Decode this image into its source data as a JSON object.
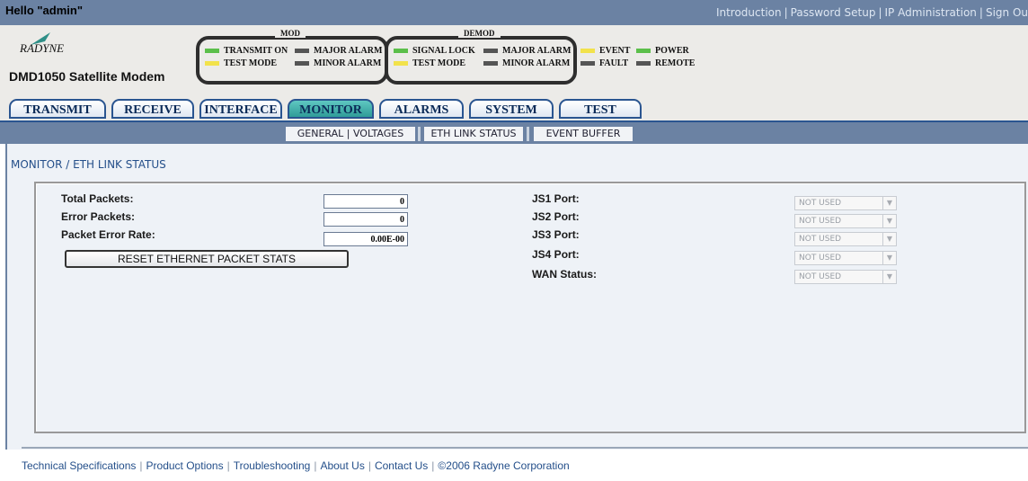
{
  "topbar": {
    "greeting": "Hello \"admin\"",
    "links": [
      "Introduction",
      "Password Setup",
      "IP Administration",
      "Sign Ou"
    ]
  },
  "header": {
    "logo_text": "RADYNE",
    "model": "DMD1050 Satellite Modem",
    "mod": {
      "title": "MOD",
      "indicators": [
        {
          "label": "TRANSMIT ON",
          "color": "#5bbf4a"
        },
        {
          "label": "MAJOR ALARM",
          "color": "#555555"
        },
        {
          "label": "TEST MODE",
          "color": "#f2e24b"
        },
        {
          "label": "MINOR ALARM",
          "color": "#555555"
        }
      ]
    },
    "demod": {
      "title": "DEMOD",
      "indicators": [
        {
          "label": "SIGNAL LOCK",
          "color": "#5bbf4a"
        },
        {
          "label": "MAJOR ALARM",
          "color": "#555555"
        },
        {
          "label": "TEST MODE",
          "color": "#f2e24b"
        },
        {
          "label": "MINOR ALARM",
          "color": "#555555"
        }
      ]
    },
    "general": [
      {
        "label": "EVENT",
        "color": "#f2e24b"
      },
      {
        "label": "POWER",
        "color": "#5bbf4a"
      },
      {
        "label": "FAULT",
        "color": "#555555"
      },
      {
        "label": "REMOTE",
        "color": "#555555"
      }
    ]
  },
  "tabs": [
    "TRANSMIT",
    "RECEIVE",
    "INTERFACE",
    "MONITOR",
    "ALARMS",
    "SYSTEM",
    "TEST"
  ],
  "active_tab": "MONITOR",
  "subnav": [
    "GENERAL | VOLTAGES",
    "ETH LINK STATUS",
    "EVENT BUFFER"
  ],
  "breadcrumb": "MONITOR / ETH LINK STATUS",
  "stats": {
    "total_packets_label": "Total Packets:",
    "total_packets_value": "0",
    "error_packets_label": "Error Packets:",
    "error_packets_value": "0",
    "per_label": "Packet Error Rate:",
    "per_value": "0.00E-00",
    "reset_label": "RESET ETHERNET PACKET STATS"
  },
  "ports": [
    {
      "label": "JS1 Port:",
      "value": "NOT USED"
    },
    {
      "label": "JS2 Port:",
      "value": "NOT USED"
    },
    {
      "label": "JS3 Port:",
      "value": "NOT USED"
    },
    {
      "label": "JS4 Port:",
      "value": "NOT USED"
    },
    {
      "label": "WAN Status:",
      "value": "NOT USED"
    }
  ],
  "footer": [
    "Technical Specifications",
    "Product Options",
    "Troubleshooting",
    "About Us",
    "Contact Us",
    "©2006 Radyne Corporation"
  ]
}
